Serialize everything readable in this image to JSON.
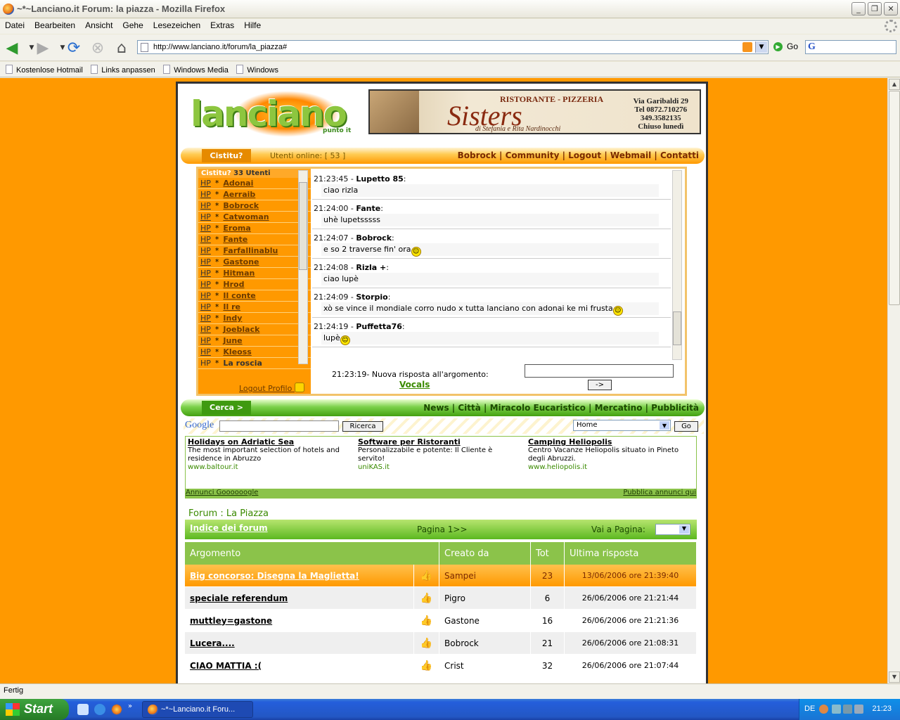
{
  "window": {
    "title": "~*~Lanciano.it Forum: la piazza - Mozilla Firefox"
  },
  "menu": [
    "Datei",
    "Bearbeiten",
    "Ansicht",
    "Gehe",
    "Lesezeichen",
    "Extras",
    "Hilfe"
  ],
  "nav": {
    "url": "http://www.lanciano.it/forum/la_piazza#",
    "go_label": "Go"
  },
  "bookmarks": [
    "Kostenlose Hotmail",
    "Links anpassen",
    "Windows Media",
    "Windows"
  ],
  "site": {
    "logo_word": "lanciano",
    "logo_sub": "punto it",
    "banner": {
      "heading": "RISTORANTE - PIZZERIA",
      "name": "Sisters",
      "by": "di Stefania e Rita Nardinocchi",
      "address": [
        "Via Garibaldi 29",
        "Tel 0872.710276",
        "349.3582135",
        "Chiuso lunedì"
      ]
    },
    "topbar": {
      "tab": "Cistitu?",
      "online": "Utenti online: [ 53 ]",
      "links": "Bobrock | Community | Logout | Webmail | Contatti"
    },
    "chat": {
      "users_header_tab": "Cistitu?",
      "users_count": "33 Utenti",
      "users": [
        "Adonai",
        "Aerraib",
        "Bobrock",
        "Catwoman",
        "Eroma",
        "Fante",
        "Farfallinablu",
        "Gastone",
        "Hitman",
        "Hrod",
        "Il conte",
        "Il re",
        "Indy",
        "Joeblack",
        "June",
        "Kleoss",
        "La roscia"
      ],
      "hp_label": "HP",
      "star": "*",
      "footer": "Logout Profilo",
      "messages": [
        {
          "time": "21:23:45",
          "user": "Lupetto 85",
          "text": "ciao rizla",
          "smiley": false
        },
        {
          "time": "21:24:00",
          "user": "Fante",
          "text": "uhè lupetsssss",
          "smiley": false
        },
        {
          "time": "21:24:07",
          "user": "Bobrock",
          "text": "e so 2 traverse fin' ora",
          "smiley": true
        },
        {
          "time": "21:24:08",
          "user": "Rizla +",
          "text": "ciao lupè",
          "smiley": false
        },
        {
          "time": "21:24:09",
          "user": "Storpio",
          "text": "xò se vince il mondiale corro nudo x tutta lanciano con adonai ke mi frusta",
          "smiley": true
        },
        {
          "time": "21:24:19",
          "user": "Puffetta76",
          "text": "lupè",
          "smiley": true
        }
      ],
      "new_reply": "21:23:19- Nuova risposta all'argomento:",
      "new_reply_link": "Vocals",
      "send_label": "->"
    },
    "greenbar": {
      "tab": "Cerca >",
      "links": "News | Città | Miracolo Eucaristico | Mercatino | Pubblicità"
    },
    "google": {
      "logo": "Google",
      "search_button": "Ricerca",
      "select_value": "Home",
      "go": "Go"
    },
    "ads": [
      {
        "title": "Holidays on Adriatic Sea",
        "body": "The most important selection of hotels and residence in Abruzzo",
        "url": "www.baltour.it"
      },
      {
        "title": "Software per Ristoranti",
        "body": "Personalizzabile e potente: Il Cliente è servito!",
        "url": "uniKAS.it"
      },
      {
        "title": "Camping Heliopolis",
        "body": "Centro Vacanze Heliopolis situato in Pineto degli Abruzzi.",
        "url": "www.heliopolis.it"
      }
    ],
    "ads_footer_left": "Annunci Goooooogle",
    "ads_footer_right": "Pubblica annunci qui",
    "forum": {
      "title": "Forum : La Piazza",
      "index_link": "Indice dei forum",
      "pagination": "Pagina 1>>",
      "goto_label": "Vai a Pagina:",
      "columns": [
        "Argomento",
        "Creato da",
        "Tot",
        "Ultima risposta"
      ],
      "threads": [
        {
          "topic": "Big concorso: Disegna la Maglietta!",
          "author": "Sampei",
          "tot": "23",
          "last": "13/06/2006 ore 21:39:40",
          "hot": true
        },
        {
          "topic": "speciale referendum",
          "author": "Pigro",
          "tot": "6",
          "last": "26/06/2006 ore 21:21:44",
          "hot": false
        },
        {
          "topic": "muttley=gastone",
          "author": "Gastone",
          "tot": "16",
          "last": "26/06/2006 ore 21:21:36",
          "hot": false
        },
        {
          "topic": "Lucera....",
          "author": "Bobrock",
          "tot": "21",
          "last": "26/06/2006 ore 21:08:31",
          "hot": false
        },
        {
          "topic": "CIAO MATTIA :(",
          "author": "Crist",
          "tot": "32",
          "last": "26/06/2006 ore 21:07:44",
          "hot": false
        }
      ]
    }
  },
  "status": {
    "text": "Fertig"
  },
  "taskbar": {
    "start": "Start",
    "task": "~*~Lanciano.it Foru...",
    "lang": "DE",
    "clock": "21:23"
  }
}
